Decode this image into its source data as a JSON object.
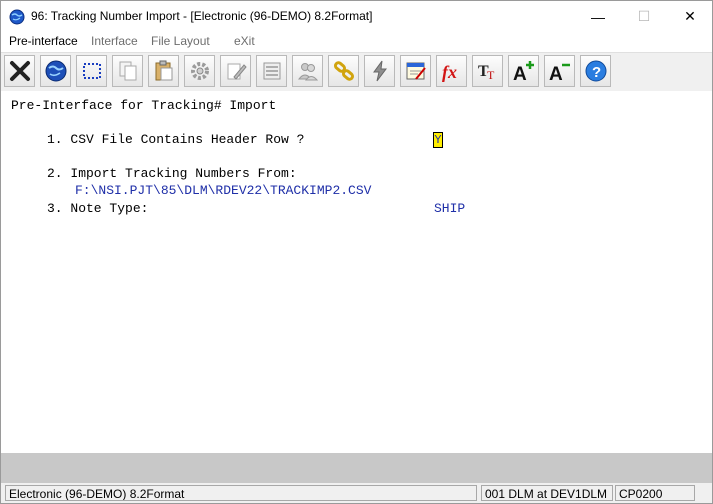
{
  "window": {
    "title": "96: Tracking Number Import - [Electronic (96-DEMO) 8.2Format]",
    "controls": {
      "minimize": "—",
      "maximize": "☐",
      "close": "✕"
    }
  },
  "menu": {
    "items": [
      {
        "label": "Pre-interface",
        "enabled": true
      },
      {
        "label": "Interface",
        "enabled": false
      },
      {
        "label": "File Layout",
        "enabled": false
      },
      {
        "label": "eXit",
        "enabled": false
      }
    ]
  },
  "toolbar": {
    "buttons": [
      "close-x-icon",
      "globe-icon",
      "select-icon",
      "copy-icon",
      "paste-icon",
      "settings-gear-icon",
      "edit-icon",
      "list-icon",
      "users-icon",
      "link-icon",
      "lightning-icon",
      "calendar-icon",
      "function-fx-icon",
      "text-format-icon",
      "font-increase-icon",
      "font-decrease-icon",
      "help-icon"
    ]
  },
  "content": {
    "heading": "Pre-Interface for Tracking# Import",
    "q1": "1. CSV File Contains Header Row ?",
    "q1_value": "Y",
    "q2": "2. Import Tracking Numbers From:",
    "q2_value": "F:\\NSI.PJT\\85\\DLM\\RDEV22\\TRACKIMP2.CSV",
    "q3": "3. Note Type:",
    "q3_value": "SHIP"
  },
  "status": {
    "company": "Electronic (96-DEMO) 8.2Format",
    "user": "001 DLM at DEV1DLM",
    "program": "CP0200"
  },
  "colors": {
    "value_text": "#1f2fa8",
    "input_highlight": "#ffee00",
    "gray_band": "#c8c8c8"
  }
}
